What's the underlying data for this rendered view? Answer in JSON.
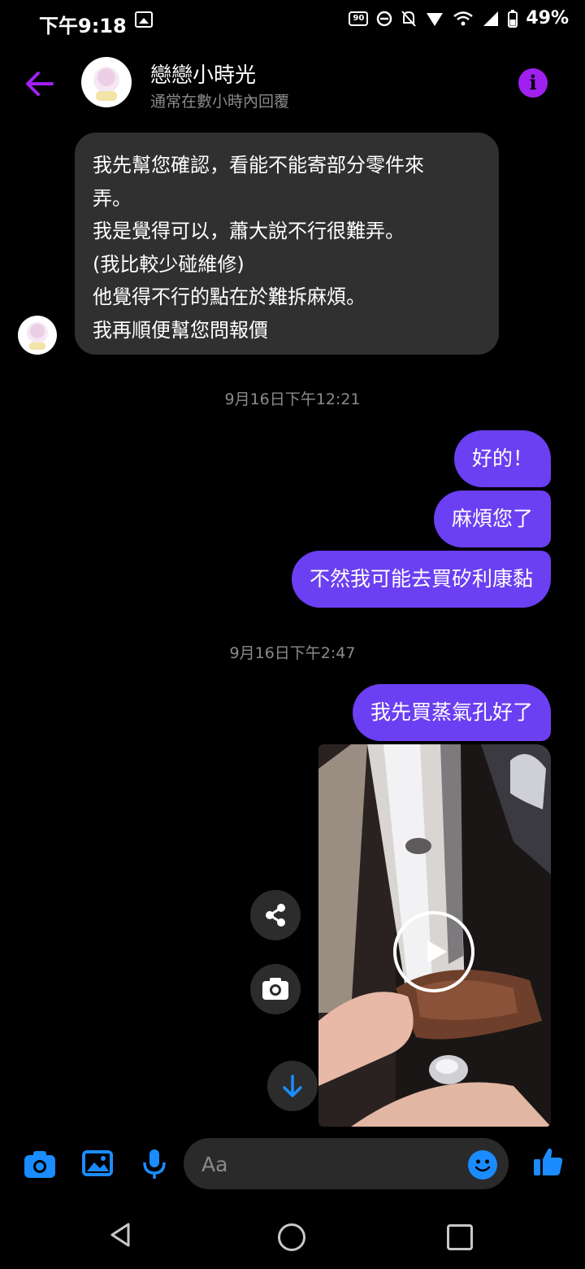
{
  "status_bar": {
    "time": "下午9:18",
    "refresh_rate": "90",
    "battery": "49%"
  },
  "header": {
    "contact_name": "戀戀小時光",
    "contact_status": "通常在數小時內回覆"
  },
  "messages": {
    "received_lines": [
      "我先幫您確認，看能不能寄部分零件來",
      "弄。",
      "我是覺得可以，蕭大說不行很難弄。",
      "(我比較少碰維修)",
      "他覺得不行的點在於難拆麻煩。",
      "我再順便幫您問報價"
    ],
    "timestamp_1": "9月16日下午12:21",
    "sent_1": "好的！",
    "sent_2": "麻煩您了",
    "sent_3": "不然我可能去買矽利康黏",
    "timestamp_2": "9月16日下午2:47",
    "sent_4": "我先買蒸氣孔好了"
  },
  "composer": {
    "placeholder": "Aa"
  },
  "colors": {
    "accent_purple": "#a020f0",
    "sent_bubble": "#6b3ff2",
    "received_bubble": "#303030",
    "composer_blue": "#1a8cff"
  },
  "icons": [
    "back-arrow-icon",
    "info-icon",
    "share-icon",
    "camera-icon",
    "arrow-down-icon",
    "image-icon",
    "microphone-icon",
    "emoji-icon",
    "thumbs-up-icon",
    "play-icon"
  ]
}
